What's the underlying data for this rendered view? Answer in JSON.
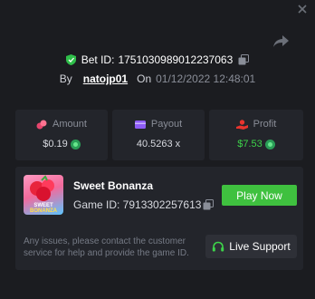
{
  "bet": {
    "id_label": "Bet ID:",
    "id_value": "1751030989012237063",
    "by_label": "By",
    "username": "natojp01",
    "on_label": "On",
    "date": "01/12/2022 12:48:01"
  },
  "stats": {
    "amount": {
      "label": "Amount",
      "value": "$0.19"
    },
    "payout": {
      "label": "Payout",
      "value": "40.5263 x"
    },
    "profit": {
      "label": "Profit",
      "value": "$7.53"
    }
  },
  "game": {
    "title": "Sweet Bonanza",
    "id_text": "Game ID: 7913302257613",
    "thumb_label_1": "SWEET",
    "thumb_label_2": "BONANZA",
    "play_label": "Play Now"
  },
  "support": {
    "message": "Any issues, please contact the customer service for help and provide the game ID.",
    "button_label": "Live Support"
  },
  "colors": {
    "background": "#1b1c20",
    "card": "#23252b",
    "accent_green": "#3fc13f",
    "profit_green": "#3dd34a",
    "amount_icon": "#e6456d",
    "payout_icon": "#8e5cf6",
    "profit_icon": "#e8342e"
  },
  "icons": [
    "close-icon",
    "share-icon",
    "shield-check-icon",
    "copy-icon",
    "coins-icon",
    "wallet-icon",
    "hand-coin-icon",
    "headset-icon"
  ]
}
